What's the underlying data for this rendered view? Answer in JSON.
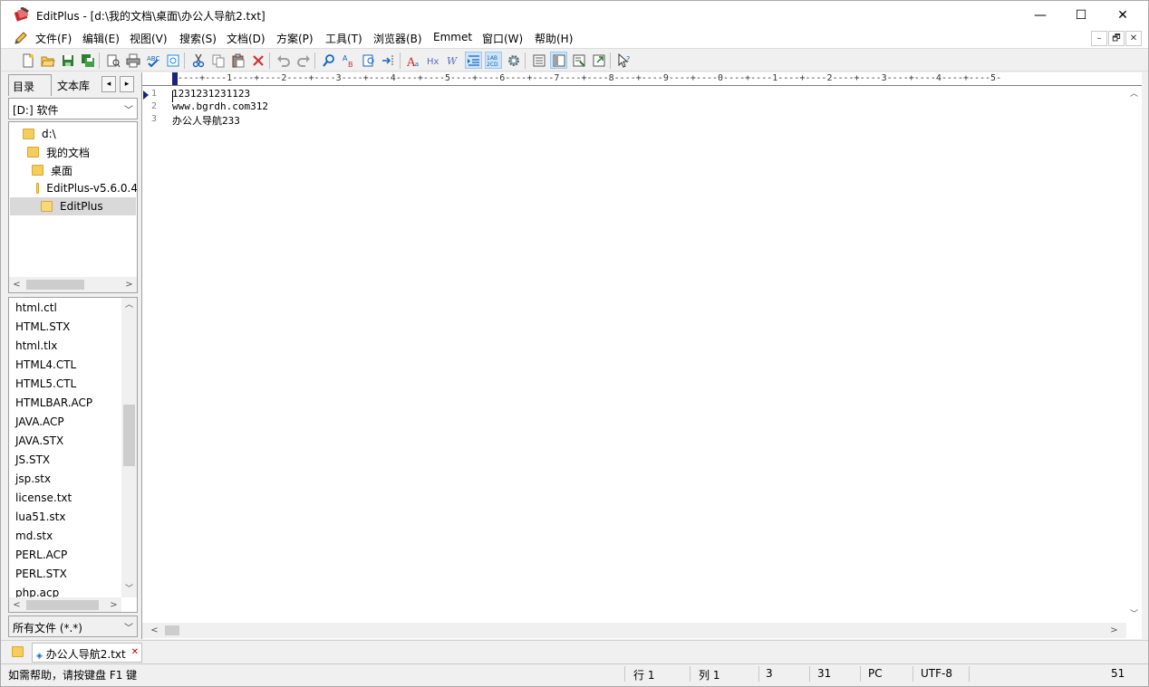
{
  "window": {
    "title": "EditPlus - [d:\\我的文档\\桌面\\办公人导航2.txt]",
    "min_glyph": "—",
    "max_glyph": "☐",
    "close_glyph": "✕"
  },
  "menu": {
    "items": [
      "文件(F)",
      "编辑(E)",
      "视图(V)",
      "搜索(S)",
      "文档(D)",
      "方案(P)",
      "工具(T)",
      "浏览器(B)",
      "Emmet",
      "窗口(W)",
      "帮助(H)"
    ],
    "mdi_buttons": [
      "–",
      "🗗",
      "✕"
    ]
  },
  "toolbar": {
    "buttons": [
      "new-file",
      "open-file",
      "save",
      "save-all",
      "print-preview",
      "print",
      "spell-check",
      "sync",
      "cut",
      "copy",
      "paste",
      "delete",
      "undo",
      "redo",
      "find",
      "replace",
      "find-in-files",
      "goto-line",
      "font",
      "hex",
      "word-wrap",
      "indent",
      "line-numbers",
      "settings",
      "panel-1",
      "panel-2",
      "panel-3",
      "panel-4",
      "help"
    ]
  },
  "sidebar": {
    "tabs": [
      "目录",
      "文本库"
    ],
    "nav_left": "◂",
    "nav_right": "▸",
    "drive": "[D:] 软件",
    "dirs": [
      {
        "label": "d:\\",
        "indent": 0
      },
      {
        "label": "我的文档",
        "indent": 1
      },
      {
        "label": "桌面",
        "indent": 2
      },
      {
        "label": "EditPlus-v5.6.0.4",
        "indent": 3
      },
      {
        "label": "EditPlus",
        "indent": 4,
        "selected": true
      }
    ],
    "files": [
      "html.ctl",
      "HTML.STX",
      "html.tlx",
      "HTML4.CTL",
      "HTML5.CTL",
      "HTMLBAR.ACP",
      "JAVA.ACP",
      "JAVA.STX",
      "JS.STX",
      "jsp.stx",
      "license.txt",
      "lua51.stx",
      "md.stx",
      "PERL.ACP",
      "PERL.STX",
      "php.acp"
    ],
    "filter": "所有文件 (*.*)"
  },
  "editor": {
    "ruler": "----+----1----+----2----+----3----+----4----+----5----+----6----+----7----+----8----+----9----+----0----+----1----+----2----+----3----+----4----+----5-",
    "line_numbers": [
      "1",
      "2",
      "3"
    ],
    "lines": [
      "1231231231123",
      "www.bgrdh.com312",
      "办公人导航233"
    ]
  },
  "doctabs": {
    "open_files": [
      "办公人导航2.txt"
    ]
  },
  "status": {
    "help": "如需帮助，请按键盘 F1 键",
    "line": "行 1",
    "col": "列 1",
    "lines_count": "3",
    "chars": "31",
    "line_ending": "PC",
    "encoding": "UTF-8",
    "size": "51"
  }
}
